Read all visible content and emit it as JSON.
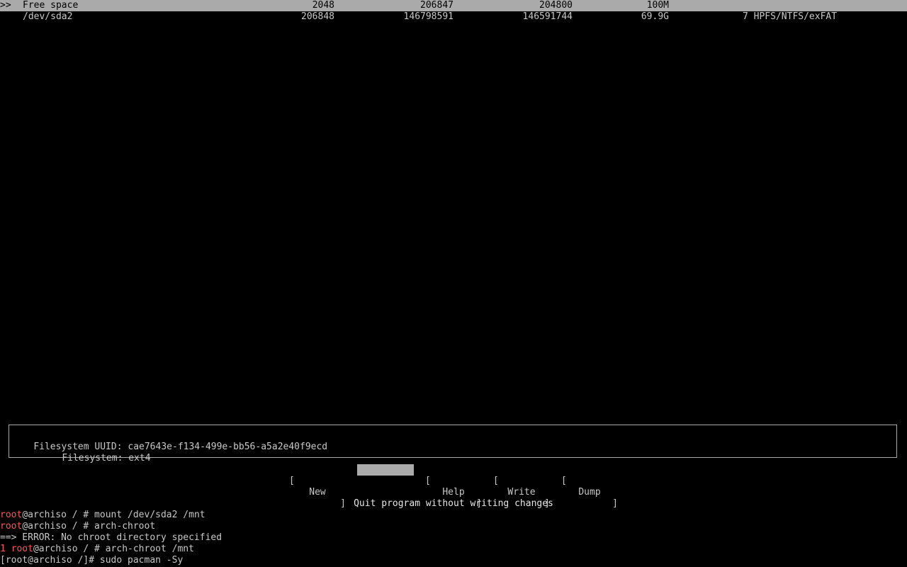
{
  "partitions": [
    {
      "marker": ">>",
      "device": "Free space",
      "start": "2048",
      "end": "206847",
      "sectors": "204800",
      "size": "100M",
      "type": "",
      "selected": true
    },
    {
      "marker": "",
      "device": "/dev/sda2",
      "start": "206848",
      "end": "146798591",
      "sectors": "146591744",
      "size": "69.9G",
      "type": "7 HPFS/NTFS/exFAT",
      "selected": false
    }
  ],
  "info": {
    "uuid_label": "Filesystem UUID:",
    "uuid_value": "cae7643e-f134-499e-bb56-a5a2e40f9ecd",
    "fs_label": "Filesystem:",
    "fs_value": "ext4"
  },
  "menu": [
    {
      "label": "New",
      "active": false
    },
    {
      "label": "Quit",
      "active": true
    },
    {
      "label": "Help",
      "active": false
    },
    {
      "label": "Write",
      "active": false
    },
    {
      "label": "Dump",
      "active": false
    }
  ],
  "hint": "Quit program without writing changes",
  "terminal": [
    {
      "status": "",
      "user": "root",
      "rest": "@archiso / # mount /dev/sda2 /mnt"
    },
    {
      "status": "",
      "user": "root",
      "rest": "@archiso / # arch-chroot"
    },
    {
      "status": "",
      "user": "",
      "rest": "==> ERROR: No chroot directory specified"
    },
    {
      "status": "1 ",
      "user": "root",
      "rest": "@archiso / # arch-chroot /mnt"
    },
    {
      "status": "",
      "user": "",
      "rest": "[root@archiso /]# sudo pacman -Sy"
    }
  ]
}
